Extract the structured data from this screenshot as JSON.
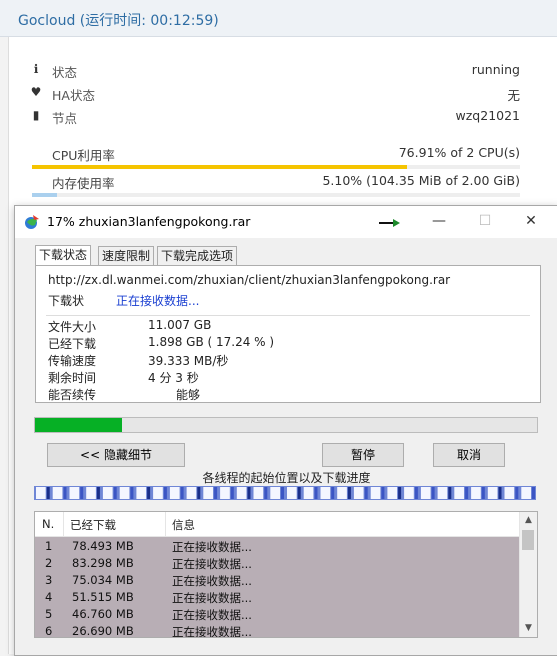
{
  "background": {
    "title": "Gocloud (运行时间: 00:12:59)",
    "stats": [
      {
        "icon": "info-icon",
        "glyph": "ℹ",
        "label": "状态",
        "value": "running"
      },
      {
        "icon": "heartbeat-icon",
        "glyph": "♥",
        "label": "HA状态",
        "value": "无"
      },
      {
        "icon": "server-icon",
        "glyph": "▮",
        "label": "节点",
        "value": "wzq21021"
      }
    ],
    "usage": [
      {
        "label": "CPU利用率",
        "value": "76.91% of 2 CPU(s)",
        "percent": 76.91,
        "color": "#f5c400"
      },
      {
        "label": "内存使用率",
        "value": "5.10% (104.35 MiB of 2.00 GiB)",
        "percent": 5.1,
        "color": "#aad0ee"
      }
    ]
  },
  "window": {
    "title": "17% zhuxian3lanfengpokong.rar",
    "minimize": "—",
    "maximize": "☐",
    "close": "✕",
    "tabs": [
      "下载状态",
      "速度限制",
      "下载完成选项"
    ],
    "url": "http://zx.dl.wanmei.com/zhuxian/client/zhuxian3lanfengpokong.rar",
    "status_label": "下载状",
    "status_value": "正在接收数据...",
    "details": [
      {
        "label": "文件大小",
        "value": "11.007  GB"
      },
      {
        "label": "已经下载",
        "value": "1.898  GB  ( 17.24 % )"
      },
      {
        "label": "传输速度",
        "value": "39.333  MB/秒"
      },
      {
        "label": "剩余时间",
        "value": "4 分 3 秒"
      },
      {
        "label": "能否续传",
        "value": "能够"
      }
    ],
    "progress_percent": 17.24,
    "buttons": {
      "hide_details": "<< 隐藏细节",
      "pause": "暂停",
      "cancel": "取消"
    },
    "segments_label": "各线程的起始位置以及下载进度",
    "list_headers": [
      "N.",
      "已经下载",
      "信息"
    ],
    "threads": [
      {
        "n": "1",
        "downloaded": "78.493  MB",
        "info": "正在接收数据..."
      },
      {
        "n": "2",
        "downloaded": "83.298  MB",
        "info": "正在接收数据..."
      },
      {
        "n": "3",
        "downloaded": "75.034  MB",
        "info": "正在接收数据..."
      },
      {
        "n": "4",
        "downloaded": "51.515  MB",
        "info": "正在接收数据..."
      },
      {
        "n": "5",
        "downloaded": "46.760  MB",
        "info": "正在接收数据..."
      },
      {
        "n": "6",
        "downloaded": "26.690  MB",
        "info": "正在接收数据..."
      }
    ],
    "colors": {
      "progress": "#06b025",
      "thread_row": "#b8aeb5",
      "status_text": "#1a3fd1"
    }
  }
}
